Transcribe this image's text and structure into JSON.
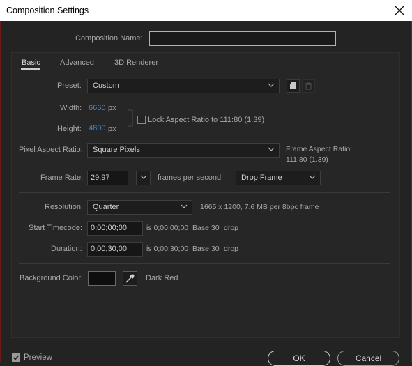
{
  "window": {
    "title": "Composition Settings"
  },
  "comp_name": {
    "label": "Composition Name:",
    "value": ""
  },
  "tabs": [
    {
      "label": "Basic",
      "active": true
    },
    {
      "label": "Advanced",
      "active": false
    },
    {
      "label": "3D Renderer",
      "active": false
    }
  ],
  "preset": {
    "label": "Preset:",
    "value": "Custom"
  },
  "width": {
    "label": "Width:",
    "value": "6660",
    "unit": "px"
  },
  "height": {
    "label": "Height:",
    "value": "4800",
    "unit": "px"
  },
  "lock_aspect": {
    "label": "Lock Aspect Ratio to 111:80 (1.39)",
    "checked": false
  },
  "pixel_aspect": {
    "label": "Pixel Aspect Ratio:",
    "value": "Square Pixels"
  },
  "frame_aspect": {
    "line1": "Frame Aspect Ratio:",
    "line2": "111:80 (1.39)"
  },
  "frame_rate": {
    "label": "Frame Rate:",
    "value": "29.97",
    "unit": "frames per second",
    "drop": "Drop Frame"
  },
  "resolution": {
    "label": "Resolution:",
    "value": "Quarter",
    "info": "1665 x 1200, 7.6 MB per 8bpc frame"
  },
  "start_timecode": {
    "label": "Start Timecode:",
    "value": "0;00;00;00",
    "is": "is 0;00;00;00",
    "base": "Base 30",
    "drop": "drop"
  },
  "duration": {
    "label": "Duration:",
    "value": "0;00;30;00",
    "is": "is 0;00;30;00",
    "base": "Base 30",
    "drop": "drop"
  },
  "background": {
    "label": "Background Color:",
    "name": "Dark Red",
    "swatch": "#0e0e0e"
  },
  "footer": {
    "preview": "Preview",
    "preview_checked": true,
    "ok": "OK",
    "cancel": "Cancel"
  },
  "colors": {
    "accent_blue": "#3f8fd8",
    "bg": "#232323"
  }
}
